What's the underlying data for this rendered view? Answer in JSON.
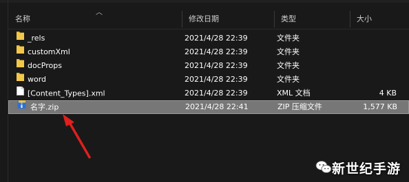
{
  "colors": {
    "background": "#191919",
    "selected_row": "#777777",
    "folder": "#e8b93b",
    "arrow": "#e0201c",
    "text": "#ffffff",
    "header_text": "#cfcfcf"
  },
  "header": {
    "columns": [
      {
        "label": "名称"
      },
      {
        "label": "修改日期"
      },
      {
        "label": "类型"
      },
      {
        "label": "大小"
      }
    ],
    "sort_icon": "chevron-up-icon"
  },
  "files": [
    {
      "name": "_rels",
      "date": "2021/4/28 22:39",
      "type": "文件夹",
      "size": "",
      "icon": "folder-icon"
    },
    {
      "name": "customXml",
      "date": "2021/4/28 22:39",
      "type": "文件夹",
      "size": "",
      "icon": "folder-icon"
    },
    {
      "name": "docProps",
      "date": "2021/4/28 22:39",
      "type": "文件夹",
      "size": "",
      "icon": "folder-icon"
    },
    {
      "name": "word",
      "date": "2021/4/28 22:39",
      "type": "文件夹",
      "size": "",
      "icon": "folder-icon"
    },
    {
      "name": "[Content_Types].xml",
      "date": "2021/4/28 22:39",
      "type": "XML 文档",
      "size": "4 KB",
      "icon": "xml-file-icon"
    },
    {
      "name": "名字.zip",
      "date": "2021/4/28 22:41",
      "type": "ZIP 压缩文件",
      "size": "1,577 KB",
      "icon": "zip-file-icon",
      "selected": true
    }
  ],
  "watermark": {
    "text": "新世纪手游",
    "icon": "wechat-icon"
  }
}
